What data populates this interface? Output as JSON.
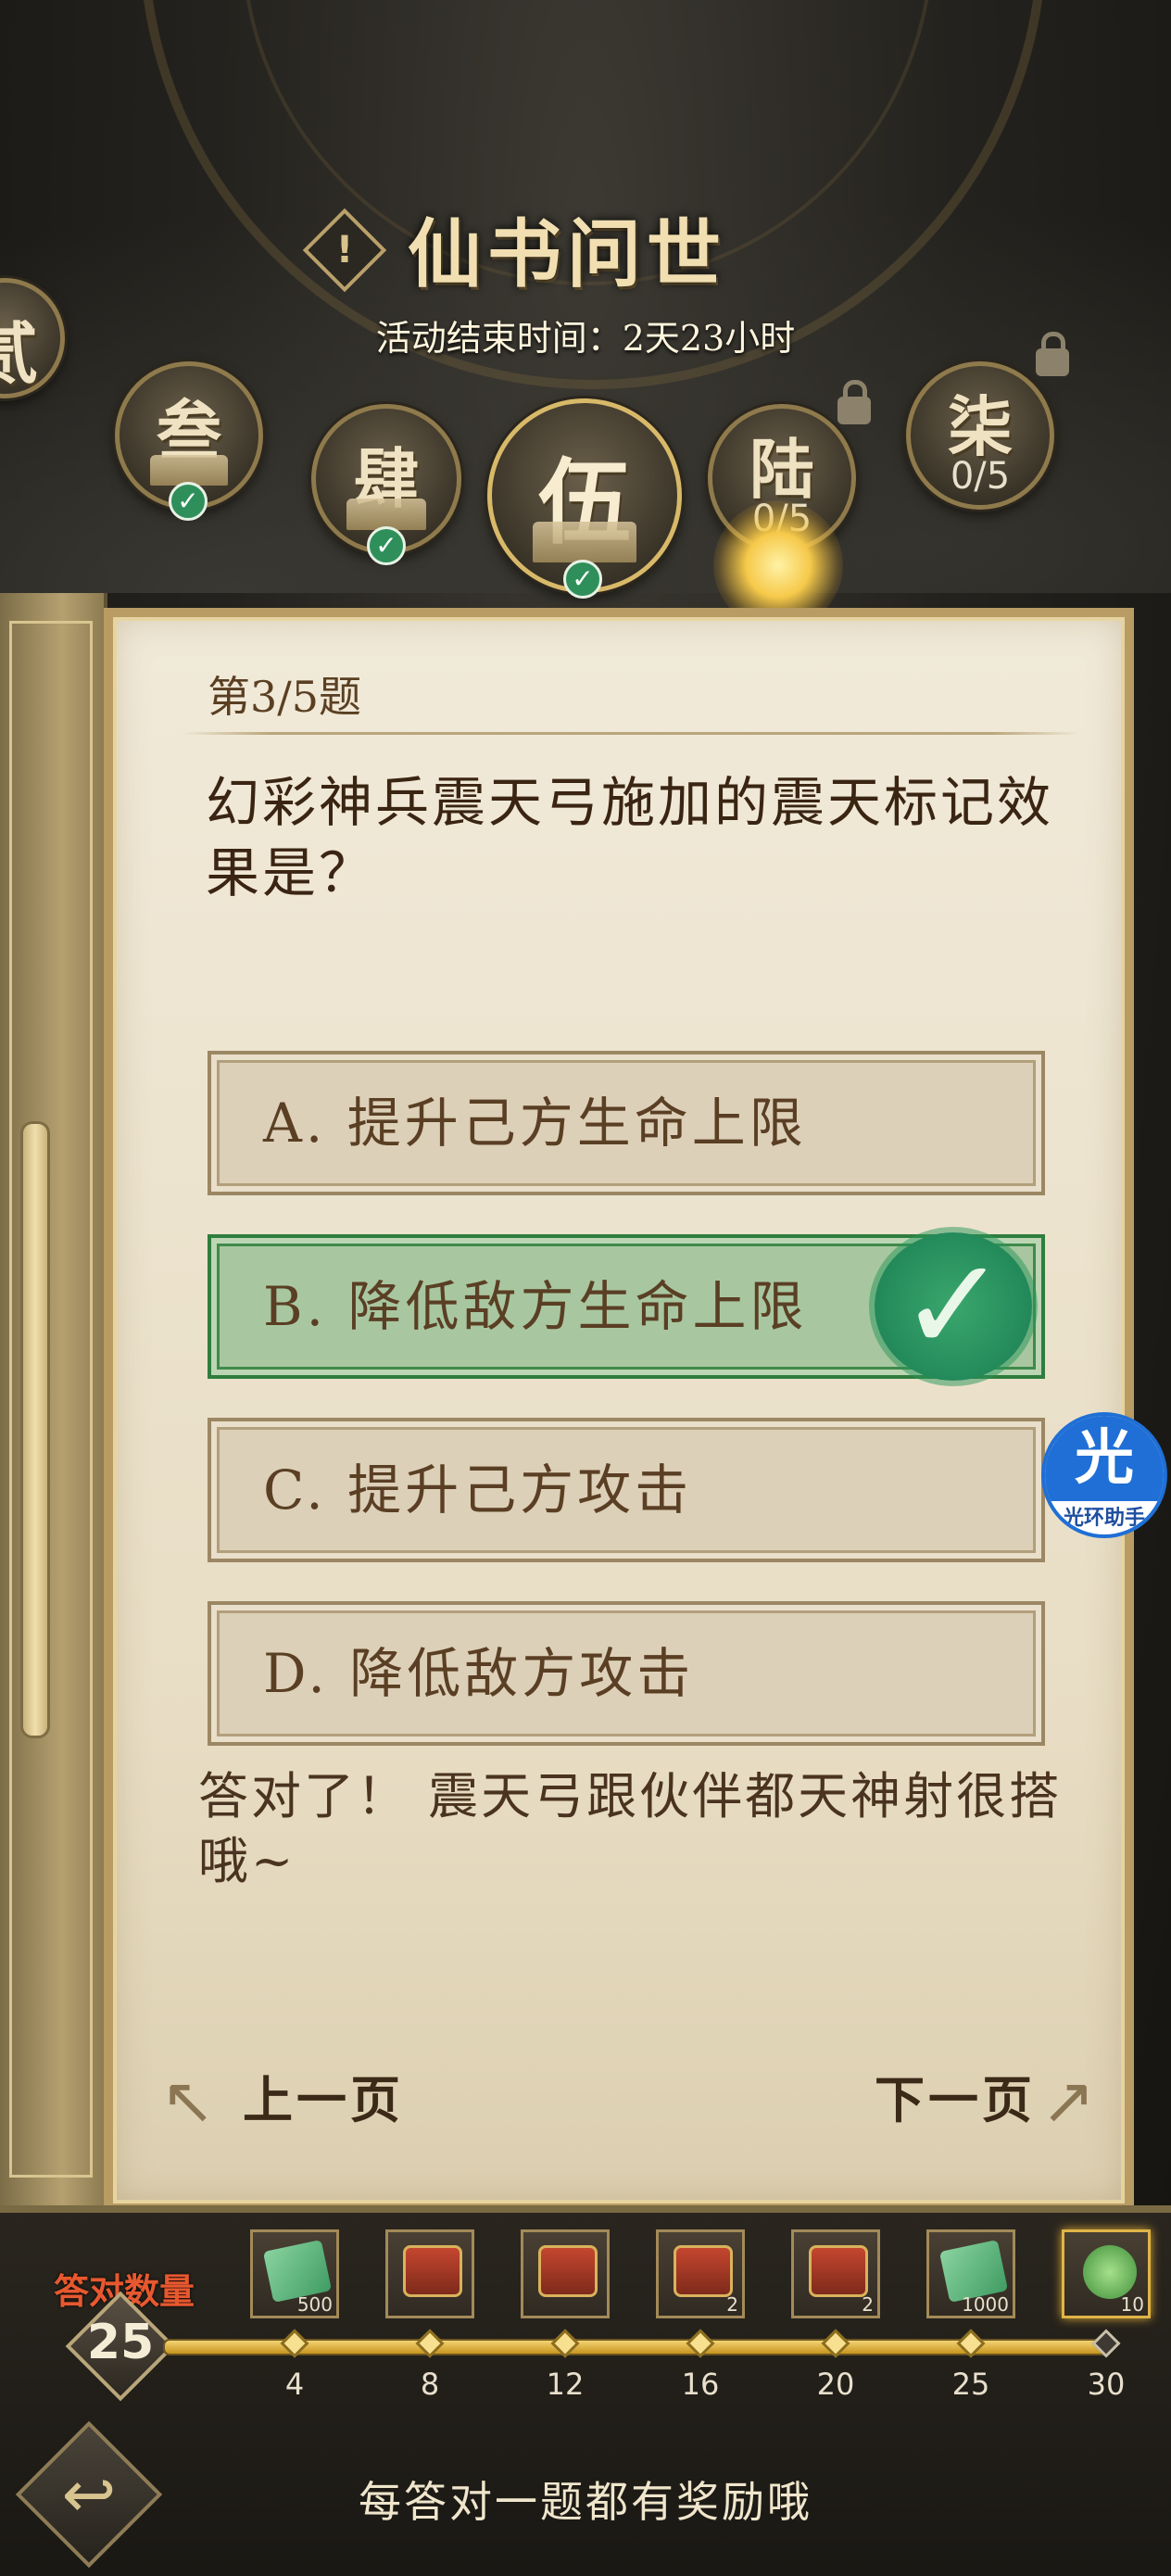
{
  "header": {
    "title": "仙书问世",
    "alert_icon": "!",
    "timer": "活动结束时间：2天23小时"
  },
  "chapters": [
    {
      "label": "贰",
      "status": "completed"
    },
    {
      "label": "叁",
      "status": "completed"
    },
    {
      "label": "肆",
      "status": "completed"
    },
    {
      "label": "伍",
      "status": "current-completed"
    },
    {
      "label": "陆",
      "status": "locked",
      "progress": "0/5"
    },
    {
      "label": "柒",
      "status": "locked",
      "progress": "0/5"
    }
  ],
  "quiz": {
    "question_number": "第3/5题",
    "question": "幻彩神兵震天弓施加的震天标记效果是？",
    "options": [
      {
        "label": "A. 提升己方生命上限",
        "correct": false
      },
      {
        "label": "B. 降低敌方生命上限",
        "correct": true
      },
      {
        "label": "C. 提升己方攻击",
        "correct": false
      },
      {
        "label": "D. 降低敌方攻击",
        "correct": false
      }
    ],
    "feedback": "答对了！ 震天弓跟伙伴都天神射很搭哦~",
    "prev_label": "上一页",
    "next_label": "下一页"
  },
  "progress": {
    "label": "答对数量",
    "value": "25",
    "current": 25,
    "max": 30,
    "milestones": [
      "4",
      "8",
      "12",
      "16",
      "20",
      "25",
      "30"
    ],
    "rewards": [
      {
        "icon": "ticket-icon",
        "qty": "500"
      },
      {
        "icon": "chest-icon",
        "qty": ""
      },
      {
        "icon": "chest-icon",
        "qty": ""
      },
      {
        "icon": "chest-icon",
        "qty": "2"
      },
      {
        "icon": "chest-icon",
        "qty": "2"
      },
      {
        "icon": "ticket-icon",
        "qty": "1000"
      },
      {
        "icon": "jade-icon",
        "qty": "10"
      }
    ]
  },
  "footer": {
    "hint": "每答对一题都有奖励哦"
  },
  "assistant": {
    "glyph": "光",
    "name": "光环助手"
  },
  "colors": {
    "accent_gold": "#b89c63",
    "correct_green": "#2f7d3e",
    "score_label": "#e7582f"
  }
}
